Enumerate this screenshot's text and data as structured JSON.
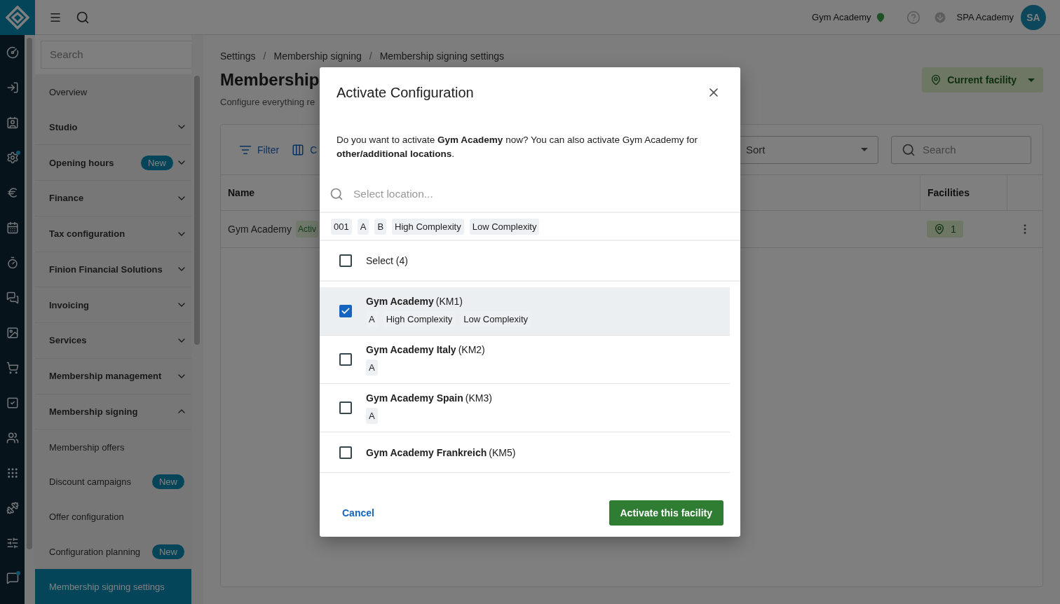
{
  "topbar": {
    "facility": "Gym Academy",
    "user": "SPA Academy",
    "avatar": "SA"
  },
  "rail": [
    {
      "notification": false
    },
    {
      "notification": false
    },
    {
      "notification": false
    },
    {
      "notification": true
    },
    {
      "notification": false
    },
    {
      "notification": false
    },
    {
      "notification": false
    },
    {
      "notification": false
    },
    {
      "notification": false
    },
    {
      "notification": false
    },
    {
      "notification": false
    },
    {
      "notification": false
    },
    {
      "notification": false
    },
    {
      "notification": false
    },
    {
      "notification": false
    },
    {
      "notification": true
    }
  ],
  "sidebar": {
    "search": {
      "placeholder": "Search"
    },
    "items": [
      {
        "label": "Overview",
        "kind": "link",
        "selected": false
      },
      {
        "label": "Studio",
        "kind": "group",
        "expanded": false
      },
      {
        "label": "Opening hours",
        "kind": "group",
        "expanded": false,
        "badge": "New"
      },
      {
        "label": "Finance",
        "kind": "group",
        "expanded": false
      },
      {
        "label": "Tax configuration",
        "kind": "group",
        "expanded": false
      },
      {
        "label": "Finion Financial Solutions",
        "kind": "group",
        "expanded": false
      },
      {
        "label": "Invoicing",
        "kind": "group",
        "expanded": false
      },
      {
        "label": "Services",
        "kind": "group",
        "expanded": false
      },
      {
        "label": "Membership management",
        "kind": "group",
        "expanded": false
      },
      {
        "label": "Membership signing",
        "kind": "group",
        "expanded": true,
        "children": [
          {
            "label": "Membership offers",
            "kind": "link",
            "selected": false
          },
          {
            "label": "Discount campaigns",
            "kind": "link",
            "selected": false,
            "badge": "New"
          },
          {
            "label": "Offer configuration",
            "kind": "link",
            "selected": false
          },
          {
            "label": "Configuration planning",
            "kind": "link",
            "selected": false,
            "badge": "New"
          },
          {
            "label": "Membership signing settings",
            "kind": "link",
            "selected": true
          }
        ]
      }
    ]
  },
  "main": {
    "breadcrumbs": [
      {
        "kind": "link",
        "text": "Settings"
      },
      {
        "kind": "separator",
        "text": "/"
      },
      {
        "kind": "link",
        "text": "Membership signing"
      },
      {
        "kind": "separator",
        "text": "/"
      },
      {
        "kind": "link",
        "text": "Membership signing settings"
      }
    ],
    "title": "Membership",
    "subtitle": "Configure everything re",
    "facility_button": "Current facility",
    "toolbar": {
      "filter": "Filter",
      "columns": "C",
      "sort": "Sort",
      "search": {
        "placeholder": "Search"
      }
    },
    "table": {
      "columns": [
        "Name",
        "Facilities"
      ],
      "rows": [
        {
          "name": "Gym Academy",
          "status": "Activ",
          "facilities": "1"
        }
      ]
    }
  },
  "dialog": {
    "title": "Activate Configuration",
    "message": "Do you want to activate **Gym Academy** now? You can also activate Gym Academy for **other/additional locations**.",
    "search": {
      "placeholder": "Select location..."
    },
    "filters": [
      "001",
      "A",
      "B",
      "High Complexity",
      "Low Complexity"
    ],
    "select_all": {
      "label": "Select (4)",
      "checked": false
    },
    "locations": [
      {
        "name": "Gym Academy",
        "code": "(KM1)",
        "tags": [
          "A",
          "High Complexity",
          "Low Complexity"
        ],
        "checked": true,
        "selected": true
      },
      {
        "name": "Gym Academy Italy",
        "code": "(KM2)",
        "tags": [
          "A"
        ],
        "checked": false,
        "selected": false
      },
      {
        "name": "Gym Academy Spain",
        "code": "(KM3)",
        "tags": [
          "A"
        ],
        "checked": false,
        "selected": false
      },
      {
        "name": "Gym Academy Frankreich",
        "code": "(KM5)",
        "checked": false,
        "selected": false
      }
    ],
    "cancel": "Cancel",
    "confirm": "Activate this facility"
  }
}
